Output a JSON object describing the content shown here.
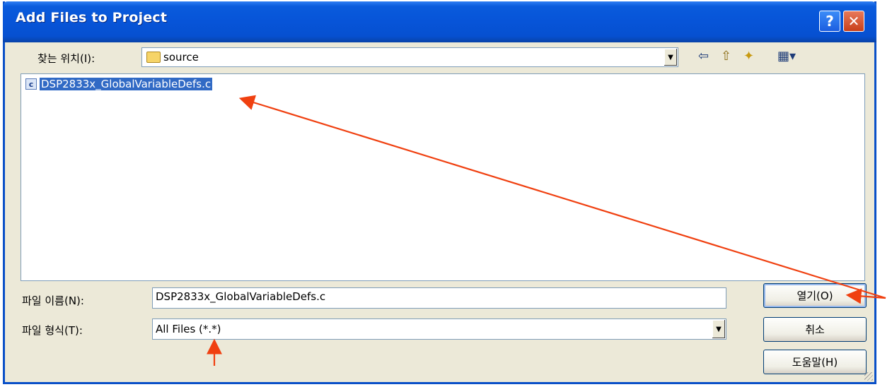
{
  "window": {
    "title": "Add Files to Project",
    "help_label": "?",
    "close_label": "✕"
  },
  "look_in": {
    "label": "찾는 위치(I):",
    "value": "source",
    "folder_icon": "folder-icon"
  },
  "toolbar": {
    "back": "⇦",
    "up": "⇧",
    "new_folder": "✦",
    "views": "▦▾"
  },
  "file_list": {
    "items": [
      {
        "icon": "c",
        "name": "DSP2833x_GlobalVariableDefs.c"
      }
    ]
  },
  "file_name": {
    "label": "파일 이름(N):",
    "value": "DSP2833x_GlobalVariableDefs.c"
  },
  "file_type": {
    "label": "파일 형식(T):",
    "value": "All Files (*.*)"
  },
  "buttons": {
    "open": "열기(O)",
    "cancel": "취소",
    "help": "도움말(H)"
  },
  "annotation_color": "#f04010"
}
